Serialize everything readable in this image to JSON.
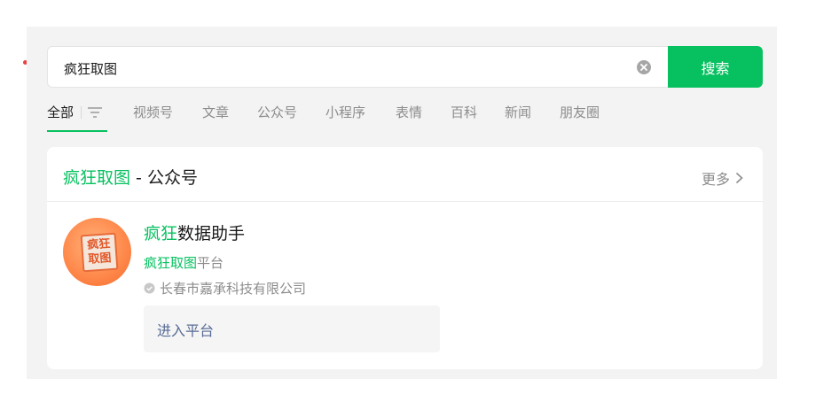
{
  "search": {
    "query": "疯狂取图",
    "button_label": "搜索"
  },
  "tabs": [
    {
      "label": "全部"
    },
    {
      "label": "视频号"
    },
    {
      "label": "文章"
    },
    {
      "label": "公众号"
    },
    {
      "label": "小程序"
    },
    {
      "label": "表情"
    },
    {
      "label": "百科"
    },
    {
      "label": "新闻"
    },
    {
      "label": "朋友圈"
    }
  ],
  "section": {
    "title_highlight": "疯狂取图",
    "title_rest": " - 公众号",
    "more_label": "更多"
  },
  "account": {
    "name_highlight": "疯狂",
    "name_rest": "数据助手",
    "desc_highlight": "疯狂取图",
    "desc_rest": "平台",
    "verified_by": "长春市嘉承科技有限公司",
    "enter_label": "进入平台",
    "avatar_text_line1": "疯狂",
    "avatar_text_line2": "取图"
  },
  "colors": {
    "accent": "#07c160",
    "link": "#576b95",
    "muted": "#8c8c8c"
  },
  "icons": {
    "clear": "clear-icon",
    "filter": "filter-icon",
    "more": "chevron-right-icon",
    "verify": "verified-icon"
  }
}
